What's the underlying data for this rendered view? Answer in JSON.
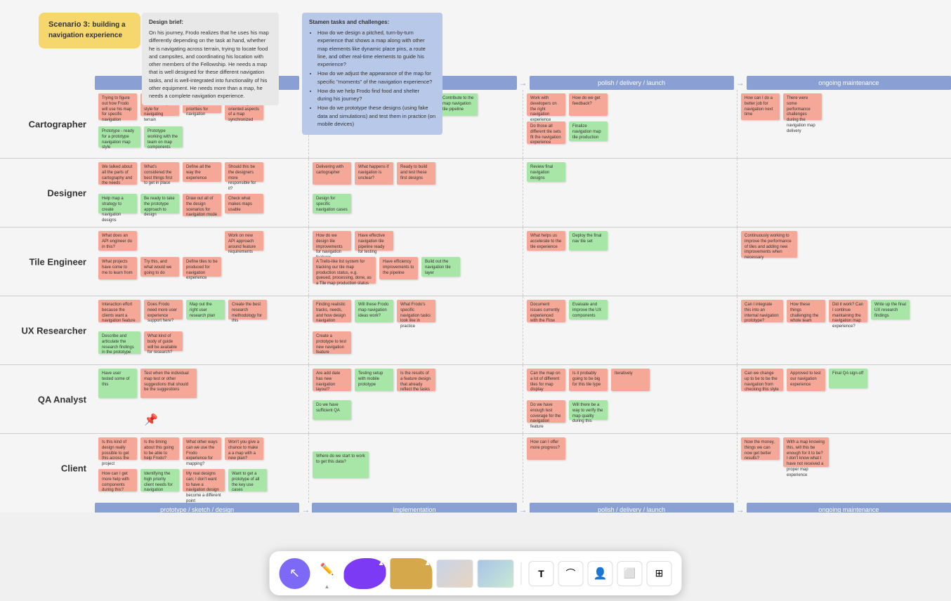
{
  "scenario": {
    "title": "Scenario 3:",
    "subtitle": "building a navigation experience"
  },
  "design_brief": {
    "title": "Design brief:",
    "content": "On his journey, Frodo realizes that he uses his map differently depending on the task at hand, whether he is navigating across terrain, trying to locate food and campsites, and coordinating his location with other members of the Fellowship. He needs a map that is well designed for these different navigation tasks, and is well-integrated into functionality of his other equipment. He needs more than a map, he needs a complete navigation experience."
  },
  "stamen_tasks": {
    "title": "Stamen tasks and challenges:",
    "items": [
      "How do we design a pitched, turn-by-turn experience that shows a map along with other map elements like dynamic place pins, a route line, and other real-time elements to guide his experience?",
      "How do we adjust the appearance of the map for specific \"moments\" of the navigation experience?",
      "How do we help Frodo find food and shelter during his journey?",
      "How do we prototype these designs (using fake data and simulations) and test them in practice (on mobile devices)"
    ]
  },
  "phases": [
    "prototype / sketch / design",
    "implementation",
    "polish / delivery / launch",
    "ongoing maintenance"
  ],
  "rows": [
    {
      "label": "Cartographer",
      "id": "cartographer"
    },
    {
      "label": "Designer",
      "id": "designer"
    },
    {
      "label": "Tile Engineer",
      "id": "tile-engineer"
    },
    {
      "label": "UX Researcher",
      "id": "ux-researcher"
    },
    {
      "label": "QA Analyst",
      "id": "qa-analyst"
    },
    {
      "label": "Client",
      "id": "client"
    }
  ],
  "toolbar": {
    "cursor_label": "cursor",
    "pen_label": "pen",
    "text_tool": "T",
    "path_tool": "path",
    "person_tool": "person",
    "frame_tool": "frame",
    "table_tool": "table"
  }
}
